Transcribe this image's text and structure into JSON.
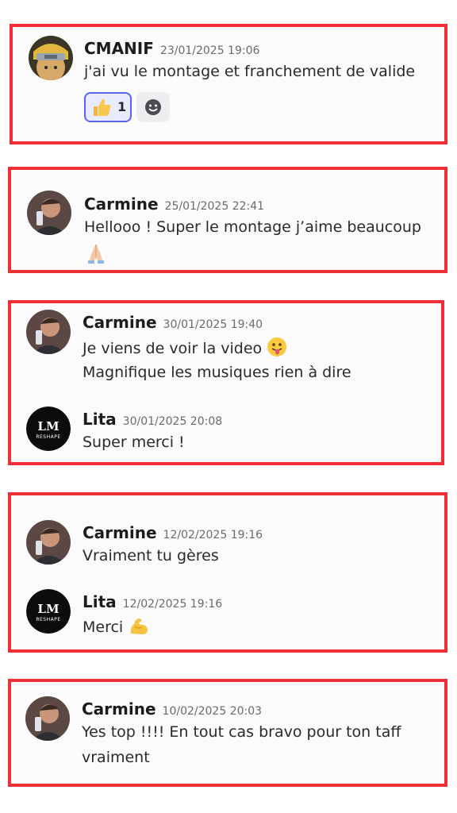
{
  "accent": "#ee2f37",
  "messages": [
    {
      "author": "CMANIF",
      "time": "23/01/2025 19:06",
      "lines": [
        "j'ai vu le montage et franchement de valide"
      ],
      "avatar": "ninja-headband-avatar",
      "reaction": {
        "emoji": "thumbs-up",
        "count": "1"
      }
    },
    {
      "author": "Carmine",
      "time": "25/01/2025 22:41",
      "lines": [
        "Hellooo ! Super le montage j’aime beaucoup"
      ],
      "emoji_line": "folded-hands",
      "avatar": "man-with-phone-avatar"
    },
    {
      "author": "Carmine",
      "time": "30/01/2025 19:40",
      "lines": [
        "Je viens de voir la video",
        "Magnifique les musiques rien à dire"
      ],
      "emoji_after_first_line": "tongue-face",
      "avatar": "man-with-phone-avatar"
    },
    {
      "author": "Lita",
      "time": "30/01/2025 20:08",
      "lines": [
        "Super merci !"
      ],
      "avatar": "lm-reshape-logo-avatar",
      "logo_text_top": "LM",
      "logo_text_bottom": "RESHAPE"
    },
    {
      "author": "Carmine",
      "time": "12/02/2025 19:16",
      "lines": [
        "Vraiment tu gères"
      ],
      "avatar": "man-with-phone-avatar"
    },
    {
      "author": "Lita",
      "time": "12/02/2025 19:16",
      "lines": [
        "Merci"
      ],
      "emoji_after_first_line": "flexed-biceps",
      "avatar": "lm-reshape-logo-avatar",
      "logo_text_top": "LM",
      "logo_text_bottom": "RESHAPE"
    },
    {
      "author": "Carmine",
      "time": "10/02/2025 20:03",
      "lines": [
        "Yes top !!!! En tout cas bravo pour ton taff",
        "vraiment"
      ],
      "avatar": "man-with-phone-avatar"
    }
  ]
}
